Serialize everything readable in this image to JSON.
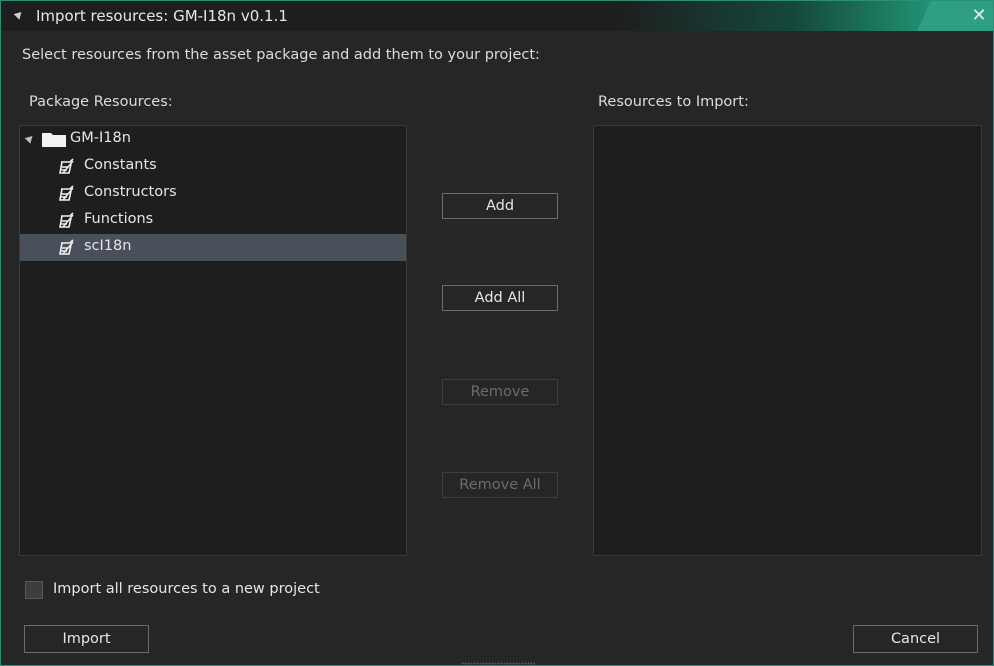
{
  "window": {
    "title": "Import resources: GM-I18n v0.1.1",
    "close_icon": "close-icon",
    "collapse_icon": "collapse-triangle-icon"
  },
  "instructions": "Select resources from the asset package and add them to your project:",
  "package_pane": {
    "label": "Package Resources:",
    "tree": {
      "root": {
        "label": "GM-I18n",
        "icon": "folder-icon",
        "expanded": true
      },
      "items": [
        {
          "label": "Constants",
          "icon": "script-icon",
          "selected": false
        },
        {
          "label": "Constructors",
          "icon": "script-icon",
          "selected": false
        },
        {
          "label": "Functions",
          "icon": "script-icon",
          "selected": false
        },
        {
          "label": "scI18n",
          "icon": "script-icon",
          "selected": true
        }
      ]
    }
  },
  "import_pane": {
    "label": "Resources to Import:",
    "items": []
  },
  "buttons": {
    "add": {
      "label": "Add",
      "enabled": true
    },
    "add_all": {
      "label": "Add All",
      "enabled": true
    },
    "remove": {
      "label": "Remove",
      "enabled": false
    },
    "remove_all": {
      "label": "Remove All",
      "enabled": false
    },
    "import": {
      "label": "Import",
      "enabled": true
    },
    "cancel": {
      "label": "Cancel",
      "enabled": true
    }
  },
  "new_project_checkbox": {
    "label": "Import all resources to a new project",
    "checked": false
  },
  "colors": {
    "accent": "#2f9f84",
    "window_bg": "#262626",
    "panel_bg": "#1e1e1e",
    "selection": "#4a4f5c"
  }
}
